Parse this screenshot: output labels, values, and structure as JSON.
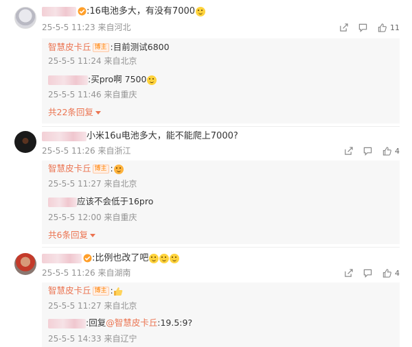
{
  "comments": [
    {
      "text": ":16电池多大，有没有7000",
      "time": "25-5-5 11:23",
      "location": "来自河北",
      "likes": "11",
      "replies": [
        {
          "user": "智慧皮卡丘",
          "badge": "博主",
          "text": ":目前测试6800",
          "time": "25-5-5 11:24",
          "location": "来自北京"
        },
        {
          "text": ":买pro啊  7500",
          "time": "25-5-5 11:46",
          "location": "来自重庆"
        }
      ],
      "more_label": "共22条回复"
    },
    {
      "text": "小米16u电池多大，能不能爬上7000?",
      "time": "25-5-5 11:26",
      "location": "来自浙江",
      "likes": "4",
      "replies": [
        {
          "user": "智慧皮卡丘",
          "badge": "博主",
          "text": ":",
          "time": "25-5-5 11:27",
          "location": "来自北京"
        },
        {
          "text": "应该不会低于16pro",
          "time": "25-5-5 12:00",
          "location": "来自重庆"
        }
      ],
      "more_label": "共6条回复"
    },
    {
      "text": ":比例也改了吧",
      "time": "25-5-5 11:26",
      "location": "来自湖南",
      "likes": "4",
      "replies": [
        {
          "user": "智慧皮卡丘",
          "badge": "博主",
          "text": ":",
          "time": "25-5-5 11:27",
          "location": "来自北京"
        },
        {
          "text": ":回复",
          "mention": "@智慧皮卡丘",
          "text2": ":19.5:9?",
          "time": "25-5-5 14:33",
          "location": "来自辽宁"
        }
      ]
    }
  ],
  "colors": {
    "username": "#eb7350",
    "meta": "#939393",
    "reply_bg": "#f7f7f7"
  },
  "icons": [
    "share-icon",
    "comment-icon",
    "like-icon",
    "vip-badge-icon",
    "emoji-icon",
    "thumbs-up-emoji-icon",
    "dropdown-triangle-icon"
  ]
}
